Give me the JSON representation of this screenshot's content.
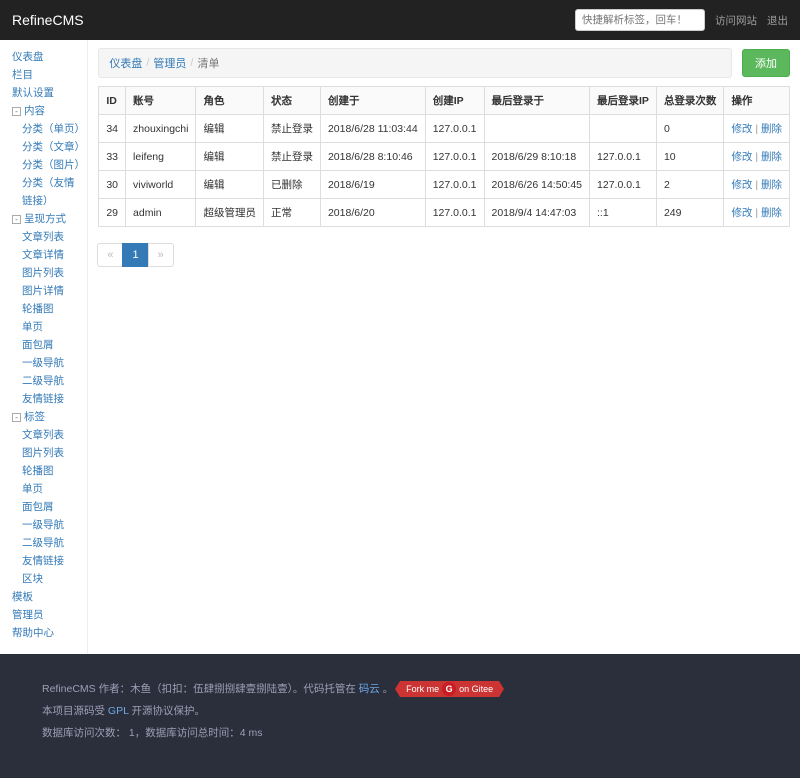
{
  "topbar": {
    "brand": "RefineCMS",
    "search_placeholder": "快捷解析标签，回车！",
    "visit_site": "访问网站",
    "logout": "退出"
  },
  "sidebar": [
    {
      "l": 1,
      "t": "仪表盘"
    },
    {
      "l": 1,
      "t": "栏目"
    },
    {
      "l": 1,
      "t": "默认设置"
    },
    {
      "l": 1,
      "t": "内容",
      "toggle": "-"
    },
    {
      "l": 2,
      "t": "分类（单页）"
    },
    {
      "l": 2,
      "t": "分类（文章）"
    },
    {
      "l": 2,
      "t": "分类（图片）"
    },
    {
      "l": 2,
      "t": "分类（友情链接）"
    },
    {
      "l": 1,
      "t": "呈现方式",
      "toggle": "-"
    },
    {
      "l": 2,
      "t": "文章列表"
    },
    {
      "l": 2,
      "t": "文章详情"
    },
    {
      "l": 2,
      "t": "图片列表"
    },
    {
      "l": 2,
      "t": "图片详情"
    },
    {
      "l": 2,
      "t": "轮播图"
    },
    {
      "l": 2,
      "t": "单页"
    },
    {
      "l": 2,
      "t": "面包屑"
    },
    {
      "l": 2,
      "t": "一级导航"
    },
    {
      "l": 2,
      "t": "二级导航"
    },
    {
      "l": 2,
      "t": "友情链接"
    },
    {
      "l": 1,
      "t": "标签",
      "toggle": "-"
    },
    {
      "l": 2,
      "t": "文章列表"
    },
    {
      "l": 2,
      "t": "图片列表"
    },
    {
      "l": 2,
      "t": "轮播图"
    },
    {
      "l": 2,
      "t": "单页"
    },
    {
      "l": 2,
      "t": "面包屑"
    },
    {
      "l": 2,
      "t": "一级导航"
    },
    {
      "l": 2,
      "t": "二级导航"
    },
    {
      "l": 2,
      "t": "友情链接"
    },
    {
      "l": 2,
      "t": "区块"
    },
    {
      "l": 1,
      "t": "模板"
    },
    {
      "l": 1,
      "t": "管理员"
    },
    {
      "l": 1,
      "t": "帮助中心"
    }
  ],
  "breadcrumb": {
    "a": "仪表盘",
    "b": "管理员",
    "c": "清单"
  },
  "add_btn": "添加",
  "columns": [
    "ID",
    "账号",
    "角色",
    "状态",
    "创建于",
    "创建IP",
    "最后登录于",
    "最后登录IP",
    "总登录次数",
    "操作"
  ],
  "ops": {
    "edit": "修改",
    "del": "删除"
  },
  "rows": [
    {
      "id": "34",
      "account": "zhouxingchi",
      "role": "编辑",
      "status": "禁止登录",
      "created": "2018/6/28 11:03:44",
      "cip": "127.0.0.1",
      "last": "",
      "lip": "",
      "count": "0"
    },
    {
      "id": "33",
      "account": "leifeng",
      "role": "编辑",
      "status": "禁止登录",
      "created": "2018/6/28 8:10:46",
      "cip": "127.0.0.1",
      "last": "2018/6/29 8:10:18",
      "lip": "127.0.0.1",
      "count": "10"
    },
    {
      "id": "30",
      "account": "viviworld",
      "role": "编辑",
      "status": "已删除",
      "created": "2018/6/19",
      "cip": "127.0.0.1",
      "last": "2018/6/26 14:50:45",
      "lip": "127.0.0.1",
      "count": "2"
    },
    {
      "id": "29",
      "account": "admin",
      "role": "超级管理员",
      "status": "正常",
      "created": "2018/6/20",
      "cip": "127.0.0.1",
      "last": "2018/9/4 14:47:03",
      "lip": "::1",
      "count": "249"
    }
  ],
  "pagination": {
    "prev": "«",
    "page1": "1",
    "next": "»"
  },
  "footer": {
    "line1_a": "RefineCMS 作者：木鱼（扣扣：伍肆捌捌肆壹捌陆壹）。代码托管在",
    "line1_link": "码云",
    "line1_b": "。",
    "ribbon_l": "Fork me",
    "ribbon_g": "G",
    "ribbon_r": "on Gitee",
    "line2_a": "本项目源码受 ",
    "line2_link": "GPL",
    "line2_b": " 开源协议保护。",
    "line3": "数据库访问次数： 1，数据库访问总时间：4 ms"
  }
}
